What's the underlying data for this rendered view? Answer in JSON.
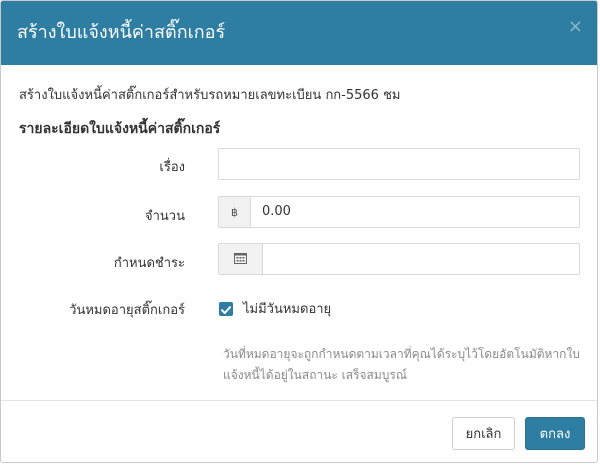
{
  "modal": {
    "title": "สร้างใบแจ้งหนี้ค่าสติ๊กเกอร์",
    "close_symbol": "×",
    "intro": "สร้างใบแจ้งหนี้ค่าสติ๊กเกอร์สำหรับรถหมายเลขทะเบียน  กก-5566 ชม",
    "section_title": "รายละเอียดใบแจ้งหนี้ค่าสติ๊กเกอร์"
  },
  "form": {
    "subject_label": "เรื่อง",
    "subject_value": "",
    "amount_label": "จำนวน",
    "currency_symbol": "฿",
    "amount_value": "0.00",
    "due_label": "กำหนดชำระ",
    "due_value": "",
    "expiry_label": "วันหมดอายุสติ๊กเกอร์",
    "no_expiry_label": "ไม่มีวันหมดอายุ",
    "no_expiry_checked": true,
    "help_text": "วันที่หมดอายุจะถูกกำหนดตามเวลาที่คุณได้ระบุไว้โดยอัตโนมัติหากใบแจ้งหนี้ได้อยู่ในสถานะ เสร็จสมบูรณ์"
  },
  "footer": {
    "cancel_label": "ยกเลิก",
    "ok_label": "ตกลง"
  },
  "colors": {
    "accent": "#2e7ea3",
    "header_text": "#ffffff"
  }
}
